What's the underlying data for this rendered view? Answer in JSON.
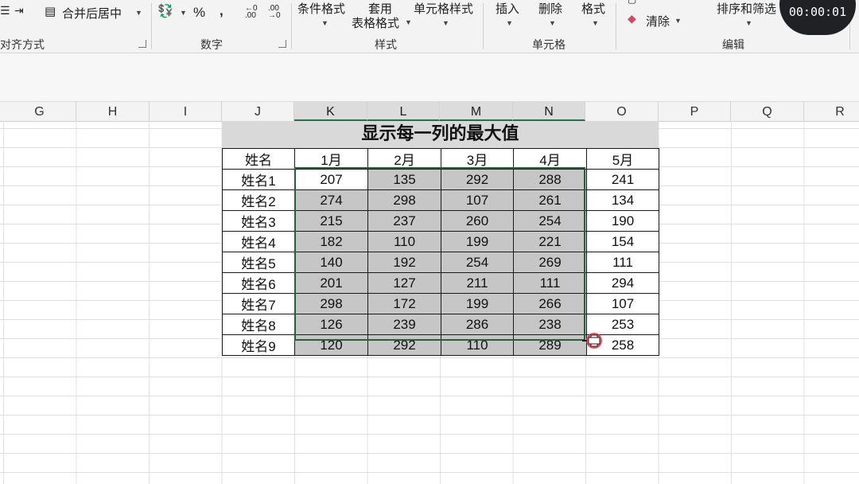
{
  "ribbon": {
    "merge_center": "合并后居中",
    "percent": "%",
    "comma": ",",
    "dec_increase": "←0 .00",
    "dec_decrease": ".00 →0",
    "conditional_format": "条件格式",
    "format_as_table_top": "套用",
    "format_as_table_bottom": "表格格式",
    "cell_styles": "单元格样式",
    "insert": "插入",
    "delete": "删除",
    "format": "格式",
    "clear": "清除",
    "sort_filter": "排序和筛选",
    "groups": {
      "alignment": "对齐方式",
      "number": "数字",
      "styles": "样式",
      "cells": "单元格",
      "editing": "编辑"
    }
  },
  "timer": "00:00:01",
  "columns": [
    "G",
    "H",
    "I",
    "J",
    "K",
    "L",
    "M",
    "N",
    "O",
    "P",
    "Q",
    "R"
  ],
  "selected_columns": [
    "K",
    "L",
    "M",
    "N"
  ],
  "table": {
    "title": "显示每一列的最大值",
    "headers": [
      "姓名",
      "1月",
      "2月",
      "3月",
      "4月",
      "5月"
    ],
    "rows": [
      [
        "姓名1",
        "207",
        "135",
        "292",
        "288",
        "241"
      ],
      [
        "姓名2",
        "274",
        "298",
        "107",
        "261",
        "134"
      ],
      [
        "姓名3",
        "215",
        "237",
        "260",
        "254",
        "190"
      ],
      [
        "姓名4",
        "182",
        "110",
        "199",
        "221",
        "154"
      ],
      [
        "姓名5",
        "140",
        "192",
        "254",
        "269",
        "111"
      ],
      [
        "姓名6",
        "201",
        "127",
        "211",
        "111",
        "294"
      ],
      [
        "姓名7",
        "298",
        "172",
        "199",
        "266",
        "107"
      ],
      [
        "姓名8",
        "126",
        "239",
        "286",
        "238",
        "253"
      ],
      [
        "姓名9",
        "120",
        "292",
        "110",
        "289",
        "258"
      ]
    ]
  },
  "colors": {
    "selection_fill": "#c6c6c6",
    "selection_border": "#2b5f3b",
    "title_fill": "#d9d9d9",
    "cursor": "#e0374b"
  }
}
